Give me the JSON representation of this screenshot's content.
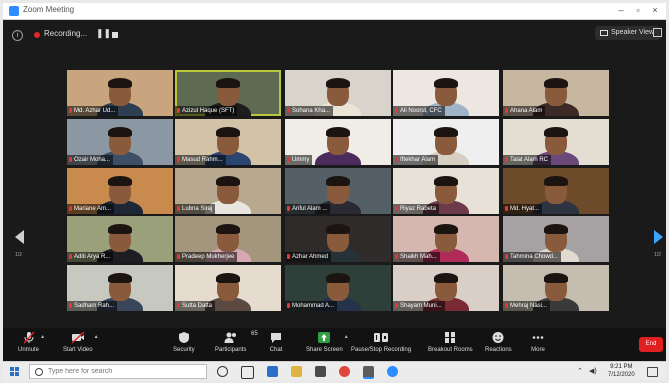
{
  "window": {
    "title": "Zoom Meeting"
  },
  "topbar": {
    "info": "i",
    "recording_label": "Recording...",
    "pause_glyph": "❚❚",
    "speaker_view_label": "Speaker View"
  },
  "gallery": {
    "page_left": "1/2",
    "page_right": "1/2",
    "tiles": [
      {
        "name": "Md. Azhar Ud..."
      },
      {
        "name": "Azizul Haque (SFT)"
      },
      {
        "name": "Sohana Kha..."
      },
      {
        "name": "Ali Noorul, CFC"
      },
      {
        "name": "Ahana Alam"
      },
      {
        "name": "Ozair Moha..."
      },
      {
        "name": "Masud Rahm..."
      },
      {
        "name": "Ummy"
      },
      {
        "name": "Iftekhar Alam"
      },
      {
        "name": "Talat Alam RC"
      },
      {
        "name": "Mariane Am..."
      },
      {
        "name": "Lubna Siraj"
      },
      {
        "name": "Ariful Alam ..."
      },
      {
        "name": "Riyaz Rabeta"
      },
      {
        "name": "Md. Hyat..."
      },
      {
        "name": "Aditi Arya R..."
      },
      {
        "name": "Pradeep Mukherjee"
      },
      {
        "name": "Azhar Ahmed"
      },
      {
        "name": "Shaikh Mah..."
      },
      {
        "name": "Tahmina Chowd..."
      },
      {
        "name": "Sadham Rah..."
      },
      {
        "name": "Sutta Datta"
      },
      {
        "name": "Mohammad A..."
      },
      {
        "name": "Shayam Muni..."
      },
      {
        "name": "Mehraj Nasi..."
      }
    ]
  },
  "toolbar": {
    "unmute": "Unmute",
    "start_video": "Start Video",
    "security": "Security",
    "participants": "Participants",
    "participants_count": "65",
    "chat": "Chat",
    "share_screen": "Share Screen",
    "pause_recording": "Pause/Stop Recording",
    "breakout_rooms": "Breakout Rooms",
    "reactions": "Reactions",
    "more": "More",
    "end": "End"
  },
  "taskbar": {
    "search_placeholder": "Type here for search",
    "time": "9:21 PM",
    "date": "7/12/2020"
  },
  "colors": {
    "accent_blue": "#2d8cff",
    "share_green": "#2ea043",
    "end_red": "#e02020",
    "active_speaker": "#b8c83a"
  }
}
